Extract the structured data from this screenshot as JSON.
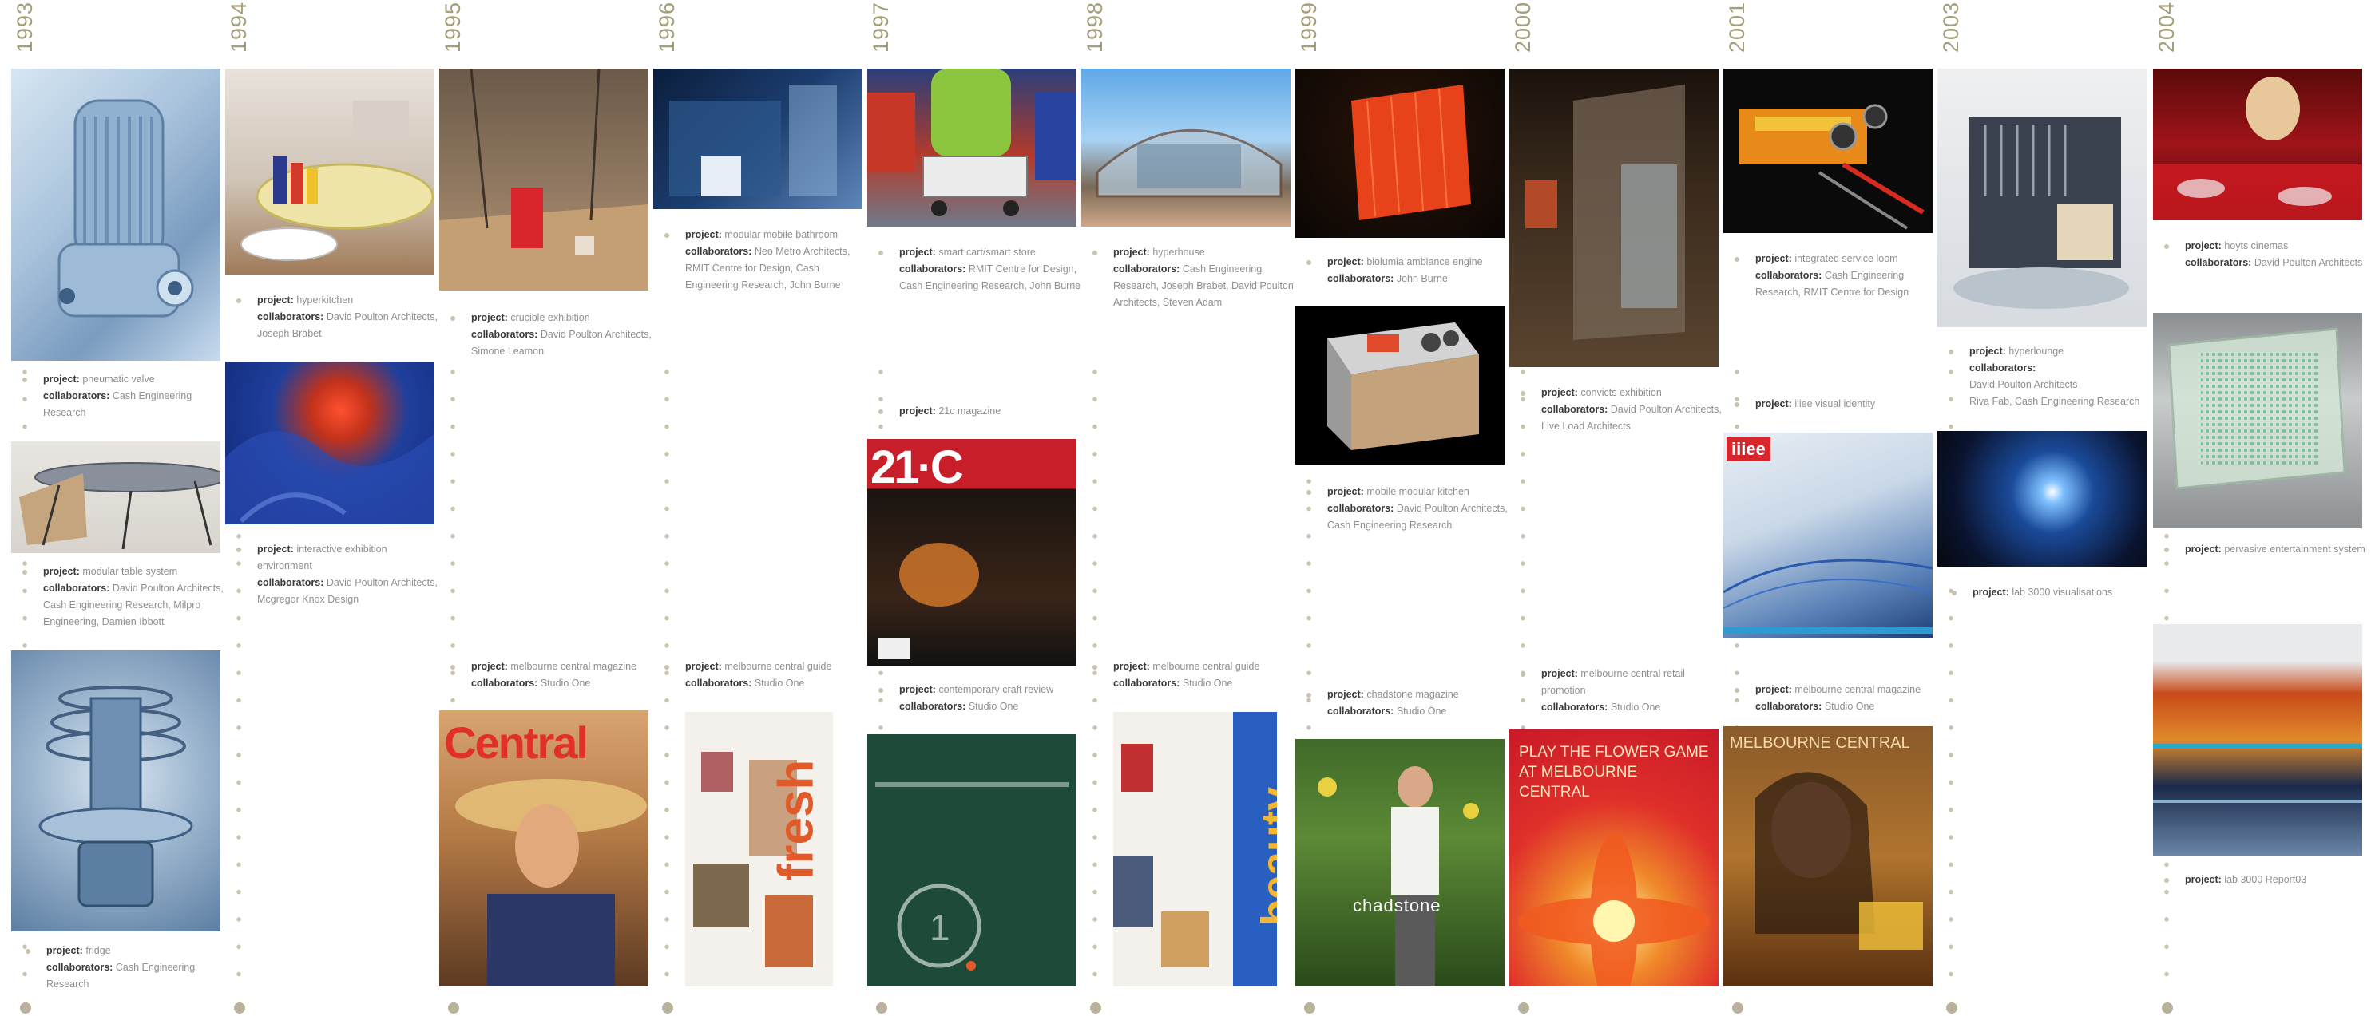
{
  "accent_year_color": "#a59e7c",
  "columns": [
    {
      "year": "1993",
      "projects": [
        {
          "project": "pneumatic valve",
          "collaborators": "Cash Engineering Research"
        },
        {
          "project": "modular table system",
          "collaborators": "David Poulton Architects, Cash Engineering Research, Milpro Engineering, Damien Ibbott"
        },
        {
          "project": "fridge",
          "collaborators": "Cash Engineering Research"
        }
      ]
    },
    {
      "year": "1994",
      "projects": [
        {
          "project": "hyperkitchen",
          "collaborators": "David Poulton Architects, Joseph Brabet"
        },
        {
          "project": "interactive exhibition environment",
          "collaborators": "David Poulton Architects, Mcgregor Knox Design"
        }
      ]
    },
    {
      "year": "1995",
      "projects": [
        {
          "project": "crucible exhibition",
          "collaborators": "David Poulton Architects, Simone Leamon"
        },
        {
          "project": "melbourne central magazine",
          "collaborators": "Studio One"
        }
      ],
      "magazine_text": "Central"
    },
    {
      "year": "1996",
      "projects": [
        {
          "project": "modular mobile bathroom",
          "collaborators": "Neo Metro Architects, RMIT Centre for Design, Cash Engineering Research, John Burne"
        },
        {
          "project": "melbourne central guide",
          "collaborators": "Studio One"
        }
      ],
      "magazine_text": "fresh"
    },
    {
      "year": "1997",
      "projects": [
        {
          "project": "smart cart/smart store",
          "collaborators": "RMIT Centre for Design, Cash Engineering Research, John Burne"
        },
        {
          "project": "21c magazine",
          "collaborators": ""
        },
        {
          "project": "contemporary craft review",
          "collaborators": "Studio One"
        }
      ],
      "magazine_text": "21·C"
    },
    {
      "year": "1998",
      "projects": [
        {
          "project": "hyperhouse",
          "collaborators": "Cash Engineering Research, Joseph Brabet, David Poulton Architects, Steven Adam"
        },
        {
          "project": "melbourne central guide",
          "collaborators": "Studio One"
        }
      ],
      "magazine_text": "beauty"
    },
    {
      "year": "1999",
      "projects": [
        {
          "project": "biolumia ambiance engine",
          "collaborators": "John Burne"
        },
        {
          "project": "mobile modular kitchen",
          "collaborators": "David Poulton Architects, Cash Engineering Research"
        },
        {
          "project": "chadstone magazine",
          "collaborators": "Studio One"
        }
      ],
      "magazine_text": "chadstone"
    },
    {
      "year": "2000",
      "projects": [
        {
          "project": "convicts exhibition",
          "collaborators": "David Poulton Architects, Live Load Architects"
        },
        {
          "project": "melbourne central retail promotion",
          "collaborators": "Studio One"
        }
      ],
      "magazine_text": "PLAY THE FLOWER GAME AT MELBOURNE CENTRAL"
    },
    {
      "year": "2001",
      "projects": [
        {
          "project": "integrated service loom",
          "collaborators": "Cash Engineering Research, RMIT Centre for Design"
        },
        {
          "project": "iiiee visual identity",
          "collaborators": ""
        },
        {
          "project": "melbourne central magazine",
          "collaborators": "Studio One"
        }
      ],
      "magazine_text": "MELBOURNE CENTRAL",
      "logo_text": "iiiee"
    },
    {
      "year": "2003",
      "projects": [
        {
          "project": "hyperlounge",
          "collaborators": "David Poulton Architects\nRiva Fab, Cash Engineering Research"
        },
        {
          "project": "lab 3000 visualisations",
          "collaborators": ""
        }
      ]
    },
    {
      "year": "2004",
      "projects": [
        {
          "project": "hoyts cinemas",
          "collaborators": "David Poulton Architects"
        },
        {
          "project": "pervasive entertainment system",
          "collaborators": ""
        },
        {
          "project": "lab 3000 Report03",
          "collaborators": ""
        }
      ]
    }
  ],
  "labels": {
    "project": "project:",
    "collaborators": "collaborators:"
  }
}
